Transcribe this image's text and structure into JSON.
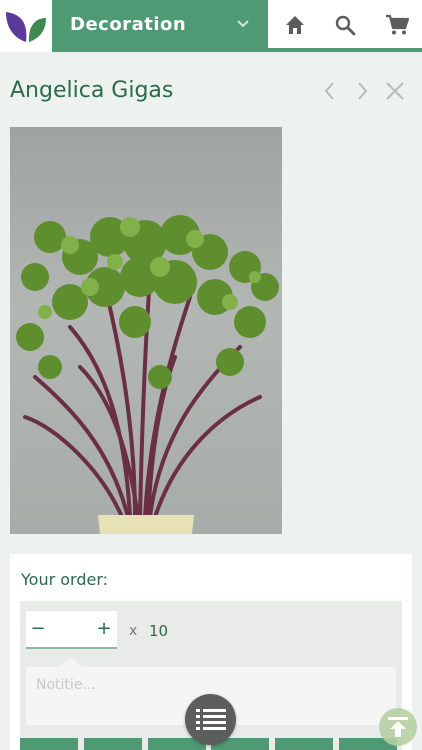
{
  "header": {
    "logo_icon": "leaf-logo-icon",
    "category": "Decoration",
    "icons": [
      "chevron-down-icon",
      "home-icon",
      "search-icon",
      "cart-icon"
    ],
    "colors": {
      "brand_green": "#4f9a74",
      "logo_purple": "#5a3a9a",
      "logo_green": "#3f8a4f"
    }
  },
  "product": {
    "title": "Angelica Gigas",
    "nav_icons": [
      "chevron-left-icon",
      "chevron-right-icon",
      "close-icon"
    ]
  },
  "order": {
    "label": "Your order:",
    "minus_label": "−",
    "plus_label": "+",
    "quantity": "",
    "times": "x",
    "unit_quantity": "10",
    "note_placeholder": "Notitie..."
  },
  "floating": {
    "list_icon": "list-icon",
    "scroll_top_icon": "scroll-to-top-icon"
  }
}
